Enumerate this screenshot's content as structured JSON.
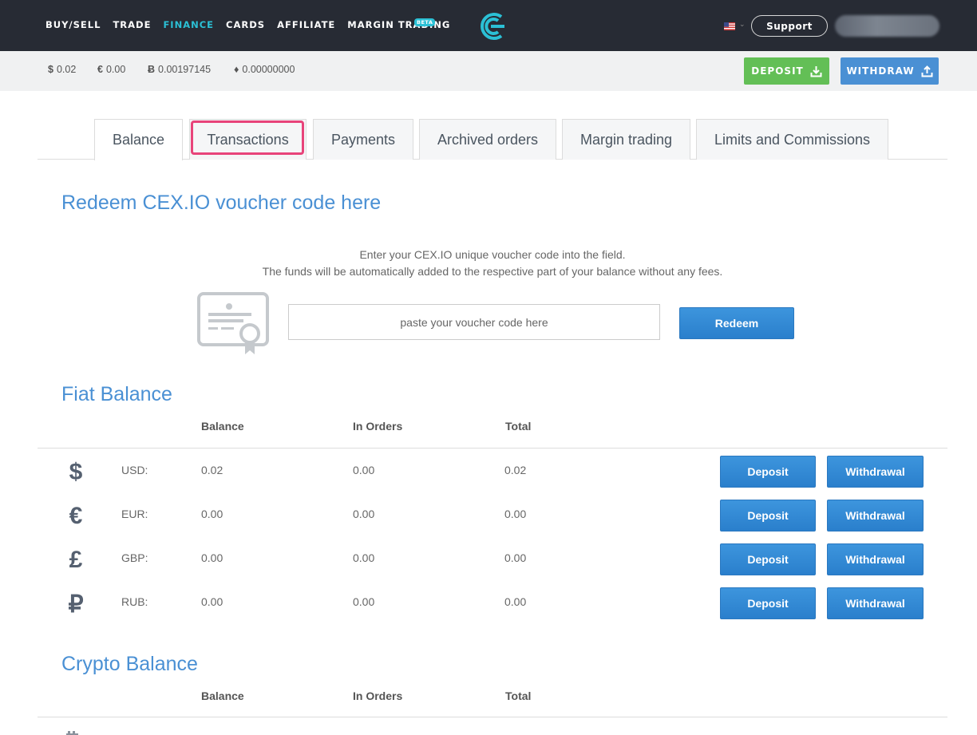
{
  "nav": {
    "links": [
      "BUY/SELL",
      "TRADE",
      "FINANCE",
      "CARDS",
      "AFFILIATE",
      "MARGIN TRADING"
    ],
    "active": "FINANCE",
    "beta_badge": "BETA",
    "support_label": "Support"
  },
  "balances_strip": [
    {
      "symbol": "$",
      "value": "0.02"
    },
    {
      "symbol": "€",
      "value": "0.00"
    },
    {
      "symbol": "Ƀ",
      "value": "0.00197145"
    },
    {
      "symbol": "♦",
      "value": "0.00000000"
    }
  ],
  "top_buttons": {
    "deposit": "DEPOSIT",
    "withdraw": "WITHDRAW"
  },
  "tabs": [
    "Balance",
    "Transactions",
    "Payments",
    "Archived orders",
    "Margin trading",
    "Limits and Commissions"
  ],
  "voucher": {
    "heading": "Redeem CEX.IO voucher code here",
    "line1": "Enter your CEX.IO unique voucher code into the field.",
    "line2": "The funds will be automatically added to the respective part of your balance without any fees.",
    "placeholder": "paste your voucher code here",
    "redeem_label": "Redeem"
  },
  "fiat": {
    "heading": "Fiat Balance",
    "columns": [
      "Balance",
      "In Orders",
      "Total"
    ],
    "rows": [
      {
        "icon": "$",
        "currency": "USD:",
        "balance": "0.02",
        "in_orders": "0.00",
        "total": "0.02"
      },
      {
        "icon": "€",
        "currency": "EUR:",
        "balance": "0.00",
        "in_orders": "0.00",
        "total": "0.00"
      },
      {
        "icon": "£",
        "currency": "GBP:",
        "balance": "0.00",
        "in_orders": "0.00",
        "total": "0.00"
      },
      {
        "icon": "₽",
        "currency": "RUB:",
        "balance": "0.00",
        "in_orders": "0.00",
        "total": "0.00"
      }
    ],
    "deposit_label": "Deposit",
    "withdrawal_label": "Withdrawal"
  },
  "crypto": {
    "heading": "Crypto Balance",
    "columns": [
      "Balance",
      "In Orders",
      "Total"
    ]
  },
  "colors": {
    "accent": "#4a90d4",
    "nav_bg": "#272b34",
    "active_nav": "#2bc0d5",
    "deposit_green": "#63bf56",
    "highlight": "#e8447a"
  }
}
